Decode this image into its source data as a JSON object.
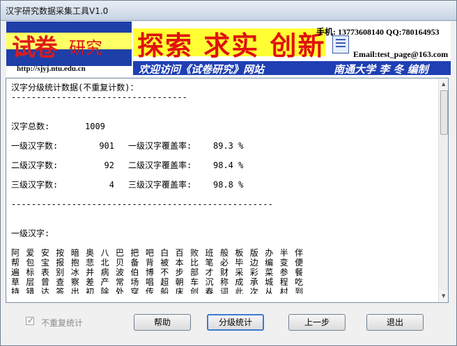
{
  "window": {
    "title": "汉字研究数据采集工具V1.0"
  },
  "banner": {
    "logo_part1": "试卷",
    "logo_part2": "研究",
    "slogan": "探索 求实 创新",
    "phone_line": "手机: 13773608140 QQ:780164953",
    "email_line": "Email:test_page@163.com",
    "url": "http://sjyj.ntu.edu.cn",
    "visit_text": "欢迎访问《试卷研究》网站",
    "author_text": "南通大学 李 冬 编制"
  },
  "content": {
    "heading": "汉字分级统计数据(不重复计数)：",
    "sep_short": "-----------------------------------",
    "total_label": "汉字总数:",
    "total_value": "1009",
    "levels": [
      {
        "label": "一级汉字数:",
        "count": "901",
        "cov_label": "一级汉字覆盖率:",
        "cov": "89.3 %"
      },
      {
        "label": "二级汉字数:",
        "count": "92",
        "cov_label": "二级汉字覆盖率:",
        "cov": "98.4 %"
      },
      {
        "label": "三级汉字数:",
        "count": "4",
        "cov_label": "三级汉字覆盖率:",
        "cov": "98.8 %"
      }
    ],
    "sep_long": "----------------------------------------------------",
    "level1_label": "一级汉字:",
    "char_rows": [
      "阿 爱 安 按 暗 奥 八 巴 把 吧 白 百 败 班 般 板 版 办 半 伴",
      "帮 包 宝 报 抱 悲 北 贝 备 背 被 本 比 笔 必 毕 边 编 变 便",
      "遍 标 表 别 冰 并 病 波 伯 博 不 步 部 才 财 采 彩 菜 参 餐",
      "草 层 曾 查 察 差 产 常 场 唱 超 朝 车 沉 称 成 承 城 程 吃",
      "持 错 达 答 出 初 除 处 穿 传 船 床 创 春 词 此 次 从 村 到"
    ]
  },
  "footer": {
    "checkbox_label": "不重复统计",
    "btn_help": "帮助",
    "btn_stats": "分级统计",
    "btn_prev": "上一步",
    "btn_exit": "退出"
  }
}
